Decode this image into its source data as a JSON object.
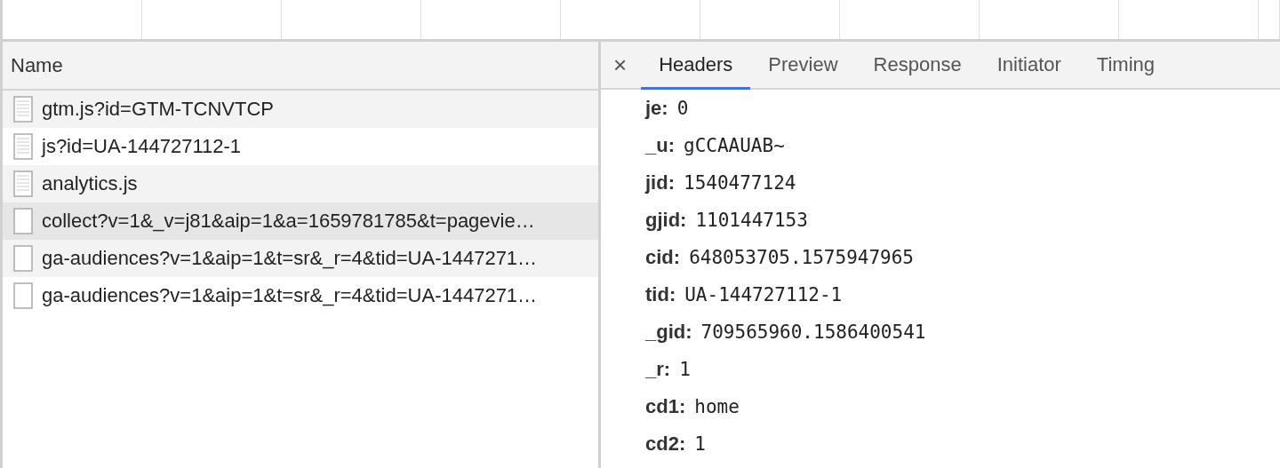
{
  "requests": {
    "column_header": "Name",
    "rows": [
      {
        "name": "gtm.js?id=GTM-TCNVTCP",
        "kind": "document",
        "selected": false
      },
      {
        "name": "js?id=UA-144727112-1",
        "kind": "document",
        "selected": false
      },
      {
        "name": "analytics.js",
        "kind": "document",
        "selected": false
      },
      {
        "name": "collect?v=1&_v=j81&aip=1&a=1659781785&t=pagevie…",
        "kind": "blank",
        "selected": true
      },
      {
        "name": "ga-audiences?v=1&aip=1&t=sr&_r=4&tid=UA-1447271…",
        "kind": "blank",
        "selected": false
      },
      {
        "name": "ga-audiences?v=1&aip=1&t=sr&_r=4&tid=UA-1447271…",
        "kind": "blank",
        "selected": false
      }
    ]
  },
  "details": {
    "close": "×",
    "tabs": [
      {
        "label": "Headers",
        "selected": true
      },
      {
        "label": "Preview",
        "selected": false
      },
      {
        "label": "Response",
        "selected": false
      },
      {
        "label": "Initiator",
        "selected": false
      },
      {
        "label": "Timing",
        "selected": false
      }
    ],
    "params": [
      {
        "key": "je:",
        "value": "0"
      },
      {
        "key": "_u:",
        "value": "gCCAAUAB~"
      },
      {
        "key": "jid:",
        "value": "1540477124"
      },
      {
        "key": "gjid:",
        "value": "1101447153"
      },
      {
        "key": "cid:",
        "value": "648053705.1575947965"
      },
      {
        "key": "tid:",
        "value": "UA-144727112-1"
      },
      {
        "key": "_gid:",
        "value": "709565960.1586400541"
      },
      {
        "key": "_r:",
        "value": "1"
      },
      {
        "key": "cd1:",
        "value": "home"
      },
      {
        "key": "cd2:",
        "value": "1"
      }
    ]
  }
}
